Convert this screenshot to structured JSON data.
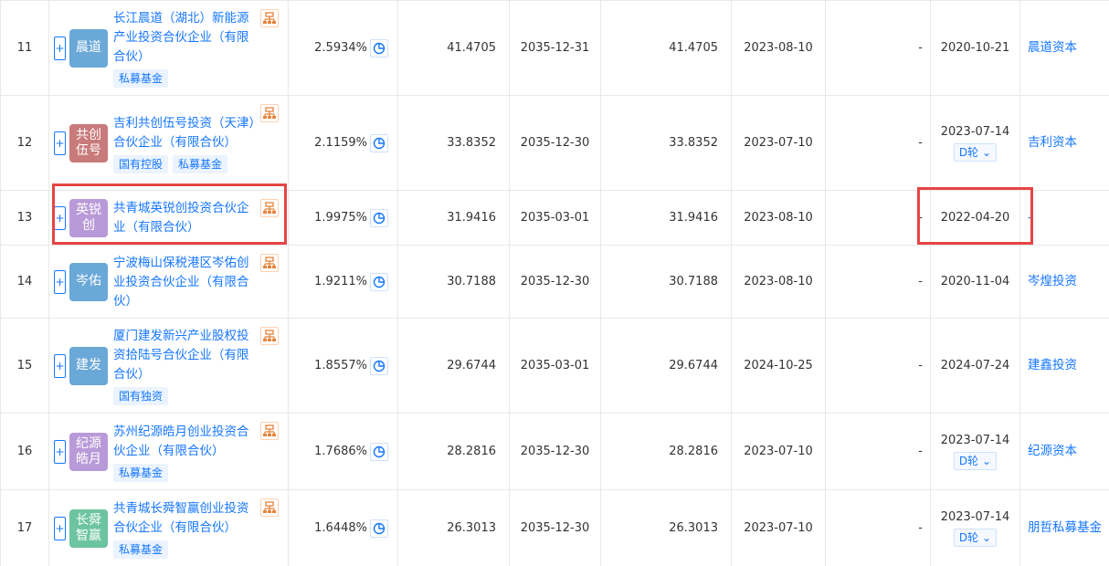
{
  "rows": [
    {
      "no": "11",
      "logo": "晨道",
      "logo_color": "#6aa8d8",
      "name": "长江晨道（湖北）新能源产业投资合伙企业（有限合伙）",
      "tags": [
        "私募基金"
      ],
      "pct": "2.5934%",
      "amount": "41.4705",
      "end": "2035-12-31",
      "paid": "41.4705",
      "date1": "2023-08-10",
      "dash": "-",
      "date2": "2020-10-21",
      "round": "",
      "investor": "晨道资本"
    },
    {
      "no": "12",
      "logo": "共创伍号",
      "logo_color": "#c97a7a",
      "name": "吉利共创伍号投资（天津）合伙企业（有限合伙）",
      "tags": [
        "国有控股",
        "私募基金"
      ],
      "pct": "2.1159%",
      "amount": "33.8352",
      "end": "2035-12-30",
      "paid": "33.8352",
      "date1": "2023-07-10",
      "dash": "-",
      "date2": "2023-07-14",
      "round": "D轮",
      "investor": "吉利资本"
    },
    {
      "no": "13",
      "logo": "英锐创",
      "logo_color": "#b99ad8",
      "name": "共青城英锐创投资合伙企业（有限合伙）",
      "tags": [],
      "pct": "1.9975%",
      "amount": "31.9416",
      "end": "2035-03-01",
      "paid": "31.9416",
      "date1": "2023-08-10",
      "dash": "-",
      "date2": "2022-04-20",
      "round": "",
      "investor": "-"
    },
    {
      "no": "14",
      "logo": "岑佑",
      "logo_color": "#6aa8d8",
      "name": "宁波梅山保税港区岑佑创业投资合伙企业（有限合伙）",
      "tags": [],
      "pct": "1.9211%",
      "amount": "30.7188",
      "end": "2035-12-30",
      "paid": "30.7188",
      "date1": "2023-08-10",
      "dash": "-",
      "date2": "2020-11-04",
      "round": "",
      "investor": "岑煌投资"
    },
    {
      "no": "15",
      "logo": "建发",
      "logo_color": "#6aa8d8",
      "name": "厦门建发新兴产业股权投资拾陆号合伙企业（有限合伙）",
      "tags": [
        "国有独资"
      ],
      "pct": "1.8557%",
      "amount": "29.6744",
      "end": "2035-03-01",
      "paid": "29.6744",
      "date1": "2024-10-25",
      "dash": "-",
      "date2": "2024-07-24",
      "round": "",
      "investor": "建鑫投资"
    },
    {
      "no": "16",
      "logo": "纪源皓月",
      "logo_color": "#b99ad8",
      "name": "苏州纪源皓月创业投资合伙企业（有限合伙）",
      "tags": [
        "私募基金"
      ],
      "pct": "1.7686%",
      "amount": "28.2816",
      "end": "2035-12-30",
      "paid": "28.2816",
      "date1": "2023-07-10",
      "dash": "-",
      "date2": "2023-07-14",
      "round": "D轮",
      "investor": "纪源资本"
    },
    {
      "no": "17",
      "logo": "长舜智赢",
      "logo_color": "#6cc4a0",
      "name": "共青城长舜智赢创业投资合伙企业（有限合伙）",
      "tags": [
        "私募基金"
      ],
      "pct": "1.6448%",
      "amount": "26.3013",
      "end": "2035-12-30",
      "paid": "26.3013",
      "date1": "2023-07-10",
      "dash": "-",
      "date2": "2023-07-14",
      "round": "D轮",
      "investor": "朋哲私募基金"
    }
  ],
  "expand_symbol": "+",
  "round_caret": "⌄"
}
